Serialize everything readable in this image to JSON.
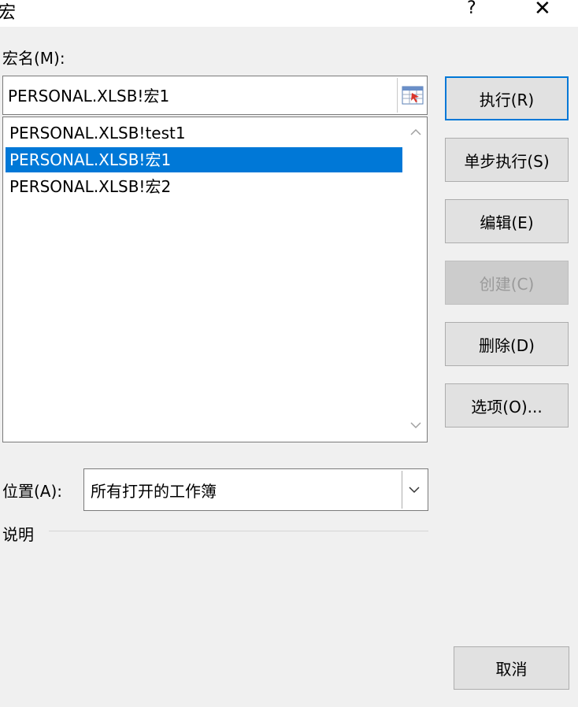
{
  "window": {
    "title": "宏",
    "help": "?",
    "close": "✕"
  },
  "macro_name_label": "宏名(M):",
  "macro_name_value": "PERSONAL.XLSB!宏1",
  "macro_list": [
    {
      "label": "PERSONAL.XLSB!test1",
      "selected": false
    },
    {
      "label": "PERSONAL.XLSB!宏1",
      "selected": true
    },
    {
      "label": "PERSONAL.XLSB!宏2",
      "selected": false
    }
  ],
  "buttons": {
    "run": "执行(R)",
    "step_into": "单步执行(S)",
    "edit": "编辑(E)",
    "create": "创建(C)",
    "delete": "删除(D)",
    "options": "选项(O)...",
    "cancel": "取消"
  },
  "location_label": "位置(A):",
  "location_value": "所有打开的工作簿",
  "description_label": "说明",
  "icons": {
    "ref": "range-selector-icon",
    "scroll_up": "chevron-up-icon",
    "scroll_down": "chevron-down-icon",
    "dropdown": "chevron-down-icon"
  },
  "colors": {
    "selection": "#0078d7",
    "default_button_border": "#0078d7"
  }
}
